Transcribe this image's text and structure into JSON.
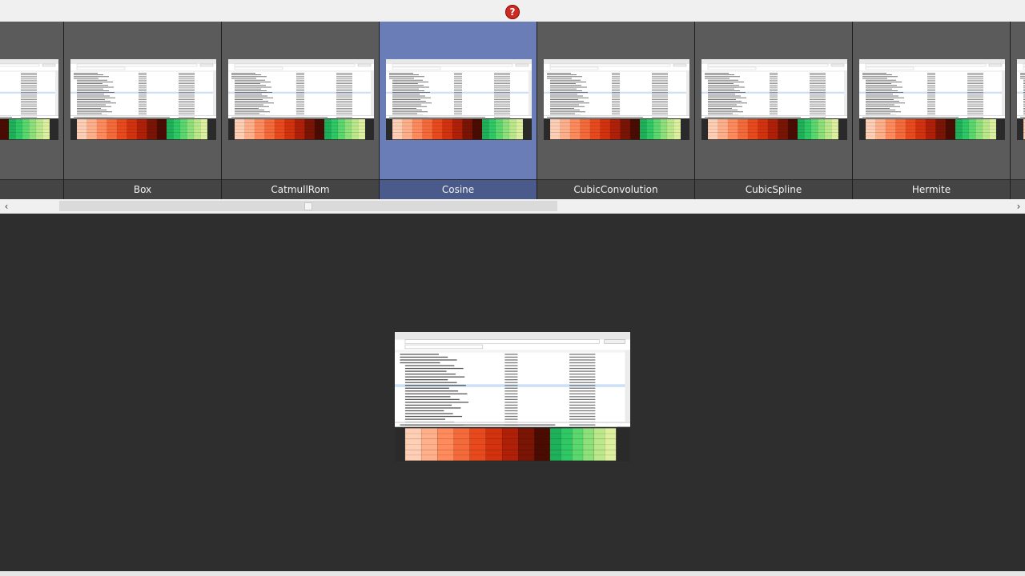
{
  "help": {
    "glyph": "?",
    "icon": "help-icon"
  },
  "filters": [
    {
      "label": "",
      "selected": false
    },
    {
      "label": "Box",
      "selected": false
    },
    {
      "label": "CatmullRom",
      "selected": false
    },
    {
      "label": "Cosine",
      "selected": true
    },
    {
      "label": "CubicConvolution",
      "selected": false
    },
    {
      "label": "CubicSpline",
      "selected": false
    },
    {
      "label": "Hermite",
      "selected": false
    },
    {
      "label": "",
      "selected": false
    }
  ],
  "scrollbar": {
    "left_icon": "chevron-left-icon",
    "right_icon": "chevron-right-icon",
    "left": "‹",
    "right": "›"
  },
  "colors": {
    "selected": "#6a7db6",
    "cell": "#5b5b5b",
    "viewer": "#2e2e2e",
    "help": "#cc2a22"
  }
}
